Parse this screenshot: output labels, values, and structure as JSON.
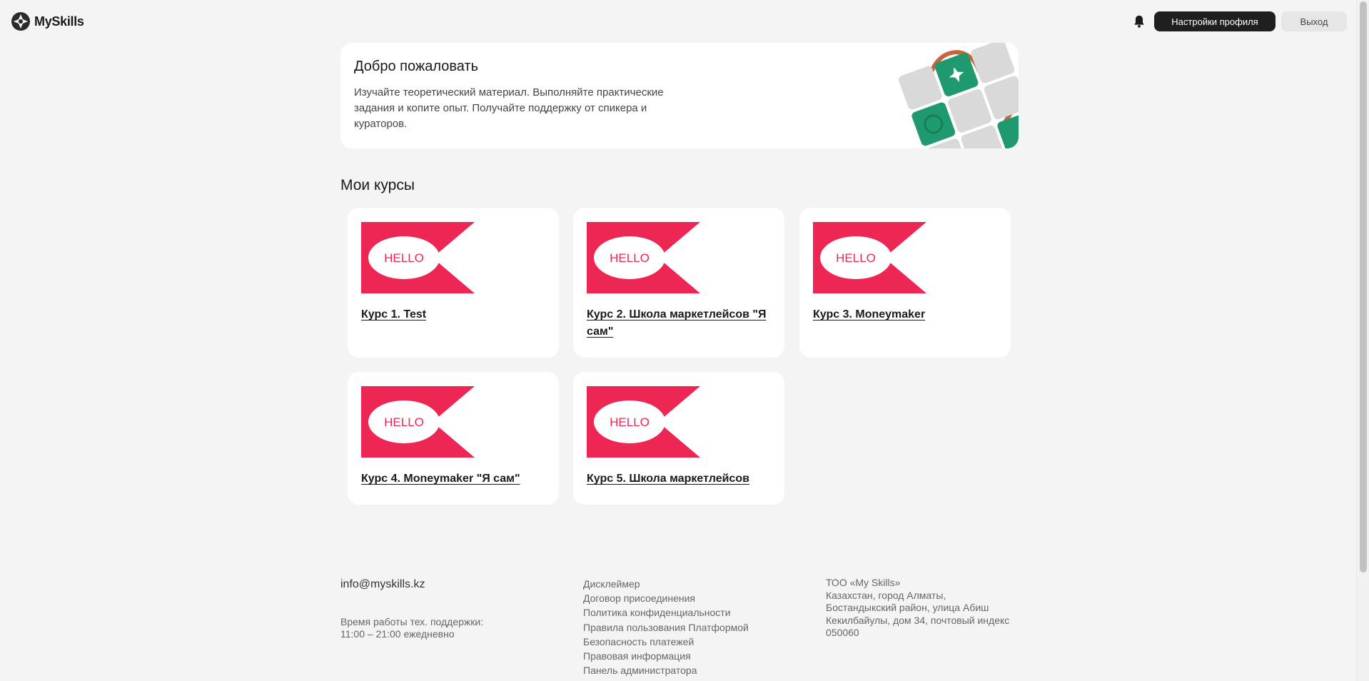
{
  "header": {
    "logo_text": "MySkills",
    "settings_label": "Настройки профиля",
    "logout_label": "Выход"
  },
  "welcome": {
    "title": "Добро пожаловать",
    "text": "Изучайте теоретический материал. Выполняйте практические задания и копите опыт. Получайте поддержку от спикера и кураторов."
  },
  "courses": {
    "section_title": "Мои курсы",
    "banner_text": "HELLO",
    "banner_color": "#ee2654",
    "items": [
      {
        "title": "Курс 1. Test"
      },
      {
        "title": "Курс 2. Школа маркетлейсов \"Я сам\""
      },
      {
        "title": "Курс 3. Moneymaker"
      },
      {
        "title": "Курс 4. Moneymaker \"Я сам\""
      },
      {
        "title": "Курс 5. Школа маркетлейсов"
      }
    ]
  },
  "footer": {
    "email": "info@myskills.kz",
    "hours": "Время работы тех. поддержки:\n11:00 – 21:00 ежедневно",
    "links": [
      "Дисклеймер",
      "Договор присоединения",
      "Политика конфиденциальности",
      "Правила пользования Платформой",
      "Безопасность платежей",
      "Правовая информация",
      "Панель администратора"
    ],
    "company": "ТОО «My Skills»\nКазахстан, город Алматы,\nБостандыкский район, улица Абиш\nКекилбайулы, дом 34, почтовый индекс\n050060"
  },
  "colors": {
    "background": "#f4f4f4",
    "card": "#ffffff",
    "primary_button": "#1f1f1f",
    "accent": "#ee2654"
  },
  "icons": {
    "logo": "myskills-logo-icon",
    "bell": "bell-icon"
  }
}
